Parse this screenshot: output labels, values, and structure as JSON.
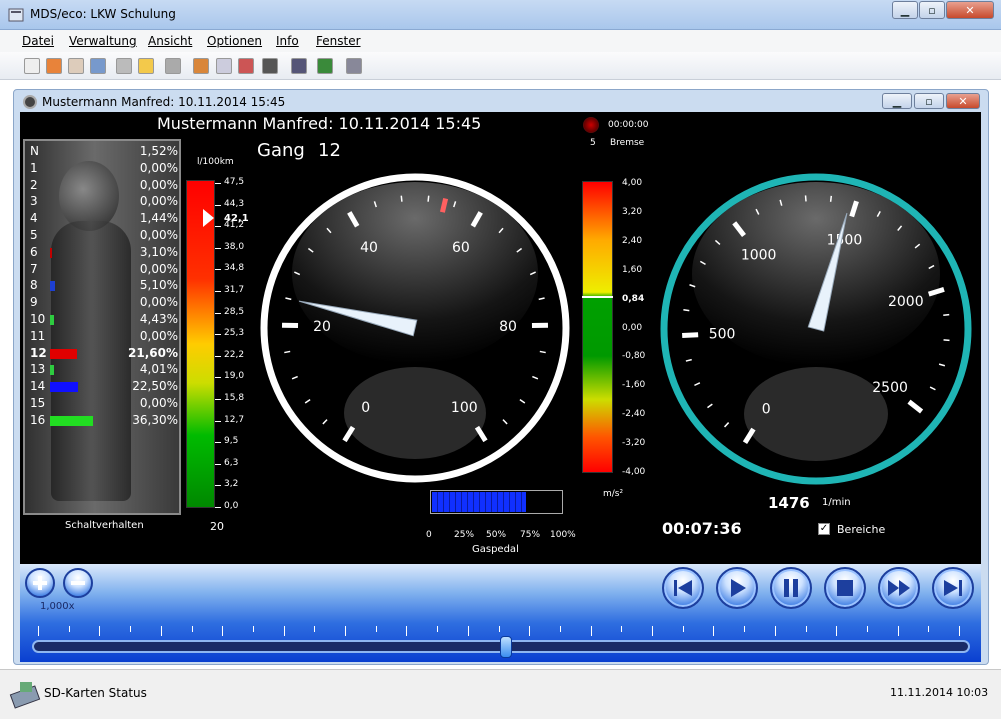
{
  "window": {
    "title": "MDS/eco: LKW Schulung"
  },
  "menu": [
    "Datei",
    "Verwaltung",
    "Ansicht",
    "Optionen",
    "Info",
    "Fenster"
  ],
  "toolbar_icons": [
    "new-icon",
    "open-icon",
    "folder-icon",
    "save-icon",
    "print-icon",
    "edit-icon",
    "archive-icon",
    "import-icon",
    "report-icon",
    "chart-icon",
    "film-icon",
    "plug-icon",
    "users-icon",
    "tool-icon"
  ],
  "mdi": {
    "title": "Mustermann Manfred: 10.11.2014 15:45"
  },
  "dashboard": {
    "header": "Mustermann Manfred: 10.11.2014 15:45",
    "gang_label": "Gang",
    "gang_value": "12",
    "brake": {
      "time": "00:00:00",
      "count": "5",
      "label": "Bremse"
    },
    "gears": [
      {
        "name": "N",
        "pct": "1,52%",
        "color": ""
      },
      {
        "name": "1",
        "pct": "0,00%",
        "color": ""
      },
      {
        "name": "2",
        "pct": "0,00%",
        "color": ""
      },
      {
        "name": "3",
        "pct": "0,00%",
        "color": ""
      },
      {
        "name": "4",
        "pct": "1,44%",
        "color": ""
      },
      {
        "name": "5",
        "pct": "0,00%",
        "color": ""
      },
      {
        "name": "6",
        "pct": "3,10%",
        "color": "#c00000"
      },
      {
        "name": "7",
        "pct": "0,00%",
        "color": ""
      },
      {
        "name": "8",
        "pct": "5,10%",
        "color": "#1d3fd0"
      },
      {
        "name": "9",
        "pct": "0,00%",
        "color": ""
      },
      {
        "name": "10",
        "pct": "4,43%",
        "color": "#2ecc40"
      },
      {
        "name": "11",
        "pct": "0,00%",
        "color": ""
      },
      {
        "name": "12",
        "pct": "21,60%",
        "color": "#e00000",
        "bold": true
      },
      {
        "name": "13",
        "pct": "4,01%",
        "color": "#2ecc40"
      },
      {
        "name": "14",
        "pct": "22,50%",
        "color": "#1010ff"
      },
      {
        "name": "15",
        "pct": "0,00%",
        "color": ""
      },
      {
        "name": "16",
        "pct": "36,30%",
        "color": "#22dd22"
      }
    ],
    "gear_bar_fraction": {
      "6": 0.04,
      "8": 0.1,
      "10": 0.08,
      "12": 0.6,
      "13": 0.08,
      "14": 0.62,
      "16": 0.96
    },
    "shift_label": "Schaltverhalten",
    "consumption": {
      "unit": "l/100km",
      "ticks": [
        "47,5",
        "44,3",
        "41,2",
        "38,0",
        "34,8",
        "31,7",
        "28,5",
        "25,3",
        "22,2",
        "19,0",
        "15,8",
        "12,7",
        "9,5",
        "6,3",
        "3,2",
        "0,0"
      ],
      "current": "42,1",
      "bottom_value": "20"
    },
    "speedo": {
      "ticks": [
        "0",
        "20",
        "40",
        "60",
        "80",
        "100"
      ],
      "value": 24
    },
    "accel": {
      "unit": "m/s²",
      "ticks": [
        "4,00",
        "3,20",
        "2,40",
        "1,60",
        "0,84",
        "0,00",
        "-0,80",
        "-1,60",
        "-2,40",
        "-3,20",
        "-4,00"
      ],
      "current": "0,84"
    },
    "pedal": {
      "label": "Gaspedal",
      "ticks": [
        "0",
        "25%",
        "50%",
        "75%",
        "100%"
      ],
      "fraction": 0.72
    },
    "rpm": {
      "ticks": [
        "0",
        "500",
        "1000",
        "1500",
        "2000",
        "2500"
      ],
      "value": "1476",
      "unit": "1/min"
    },
    "elapsed": "00:07:36",
    "bereiche_label": "Bereiche"
  },
  "controls": {
    "zoom": "1,000x",
    "timeline_position": 0.505
  },
  "status": {
    "text": "SD-Karten Status",
    "datetime": "11.11.2014 10:03"
  },
  "colors": {
    "ring_speedo": "#ffffff",
    "ring_rpm": "#1fb5b5"
  }
}
